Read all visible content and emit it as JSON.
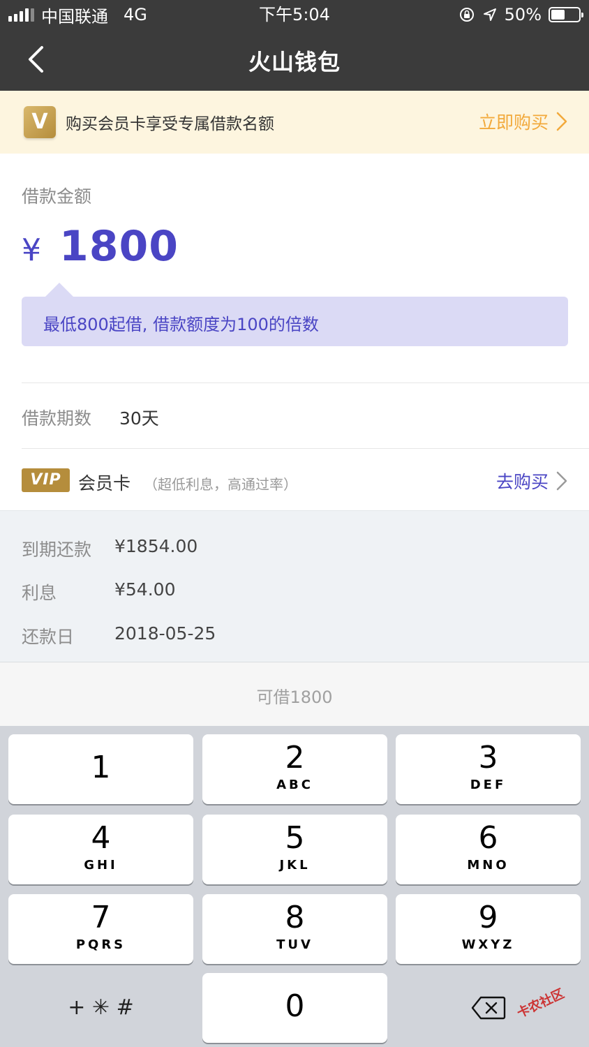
{
  "status_bar": {
    "carrier": "中国联通",
    "network": "4G",
    "time": "下午5:04",
    "battery_percent": "50%",
    "battery_level": 0.5
  },
  "nav": {
    "title": "火山钱包",
    "back_icon": "chevron-left-icon"
  },
  "promo": {
    "badge": "V",
    "text": "购买会员卡享受专属借款名额",
    "action": "立即购买"
  },
  "amount": {
    "label": "借款金额",
    "currency": "¥",
    "value": "1800",
    "tip": "最低800起借, 借款额度为100的倍数"
  },
  "term": {
    "label": "借款期数",
    "value": "30天"
  },
  "vip": {
    "badge": "VIP",
    "name": "会员卡",
    "note": "（超低利息，高通过率）",
    "action": "去购买"
  },
  "summary": {
    "rows": [
      {
        "key": "到期还款",
        "value": "¥1854.00"
      },
      {
        "key": "利息",
        "value": "¥54.00"
      },
      {
        "key": "还款日",
        "value": "2018-05-25"
      }
    ]
  },
  "available": "可借1800",
  "keypad": {
    "keys": [
      {
        "digit": "1",
        "letters": ""
      },
      {
        "digit": "2",
        "letters": "ABC"
      },
      {
        "digit": "3",
        "letters": "DEF"
      },
      {
        "digit": "4",
        "letters": "GHI"
      },
      {
        "digit": "5",
        "letters": "JKL"
      },
      {
        "digit": "6",
        "letters": "MNO"
      },
      {
        "digit": "7",
        "letters": "PQRS"
      },
      {
        "digit": "8",
        "letters": "TUV"
      },
      {
        "digit": "9",
        "letters": "WXYZ"
      }
    ],
    "symbols": "+ ✳ #",
    "zero": "0"
  },
  "watermark": "卡农社区",
  "colors": {
    "header": "#3b3b3b",
    "accent_purple": "#4a45c4",
    "accent_orange": "#f2a93b",
    "gold": "#b58d3c"
  }
}
